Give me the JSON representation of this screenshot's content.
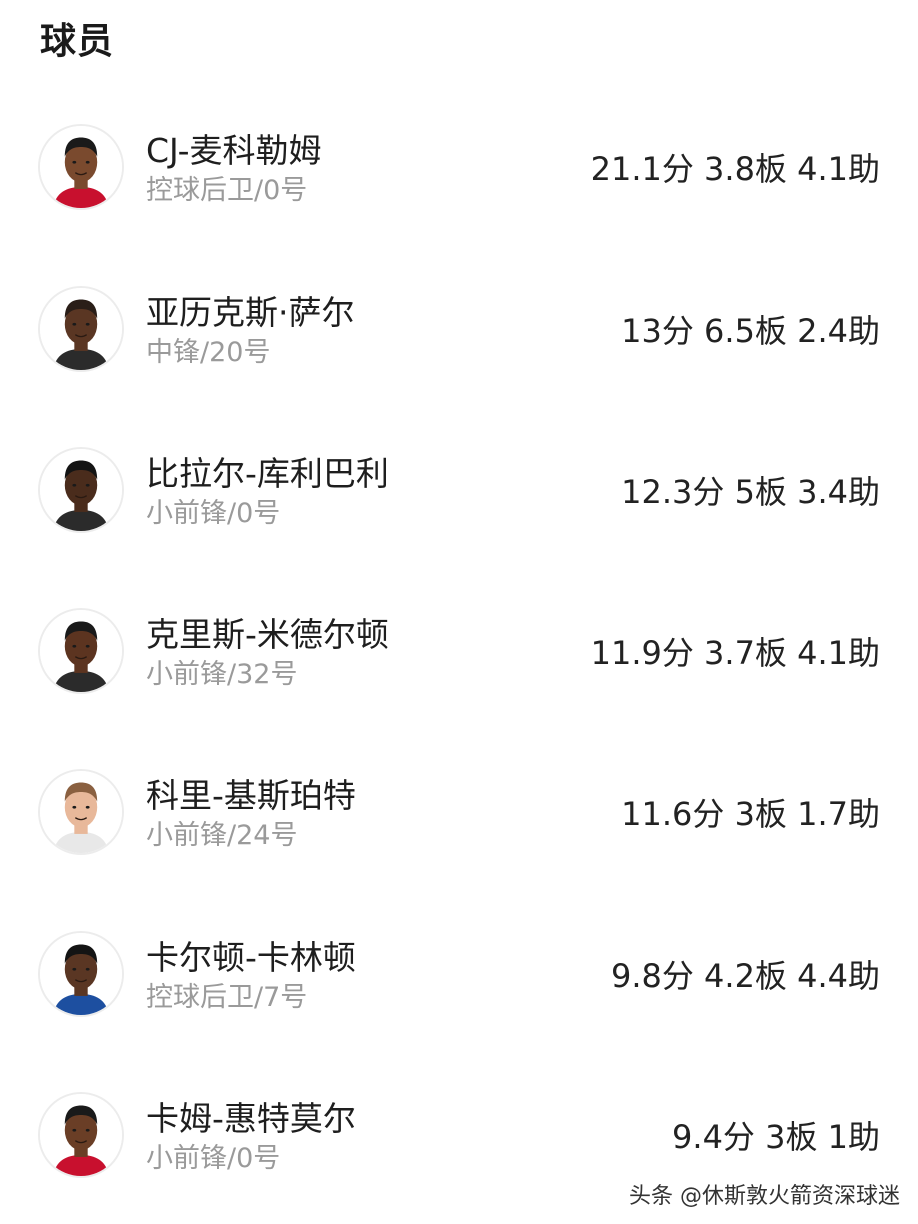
{
  "section": {
    "title": "球员"
  },
  "players": [
    {
      "name": "CJ-麦科勒姆",
      "position": "控球后卫/0号",
      "stats": "21.1分 3.8板 4.1助",
      "jersey_color": "#c8102e",
      "skin": "#7a4a2e",
      "hair": "#1a1a1a"
    },
    {
      "name": "亚历克斯·萨尔",
      "position": "中锋/20号",
      "stats": "13分 6.5板 2.4助",
      "jersey_color": "#2b2b2b",
      "skin": "#5a3623",
      "hair": "#2a1e18"
    },
    {
      "name": "比拉尔-库利巴利",
      "position": "小前锋/0号",
      "stats": "12.3分 5板 3.4助",
      "jersey_color": "#2b2b2b",
      "skin": "#4a2c1c",
      "hair": "#141414"
    },
    {
      "name": "克里斯-米德尔顿",
      "position": "小前锋/32号",
      "stats": "11.9分 3.7板 4.1助",
      "jersey_color": "#2b2b2b",
      "skin": "#5c3420",
      "hair": "#1a1a1a"
    },
    {
      "name": "科里-基斯珀特",
      "position": "小前锋/24号",
      "stats": "11.6分 3板 1.7助",
      "jersey_color": "#e8e8e8",
      "skin": "#e8b89a",
      "hair": "#8a6040"
    },
    {
      "name": "卡尔顿-卡林顿",
      "position": "控球后卫/7号",
      "stats": "9.8分 4.2板 4.4助",
      "jersey_color": "#1d4fa0",
      "skin": "#5a3623",
      "hair": "#141414"
    },
    {
      "name": "卡姆-惠特莫尔",
      "position": "小前锋/0号",
      "stats": "9.4分 3板 1助",
      "jersey_color": "#c8102e",
      "skin": "#6a3e26",
      "hair": "#1a1a1a"
    }
  ],
  "watermark": {
    "text": "头条 @休斯敦火箭资深球迷"
  }
}
